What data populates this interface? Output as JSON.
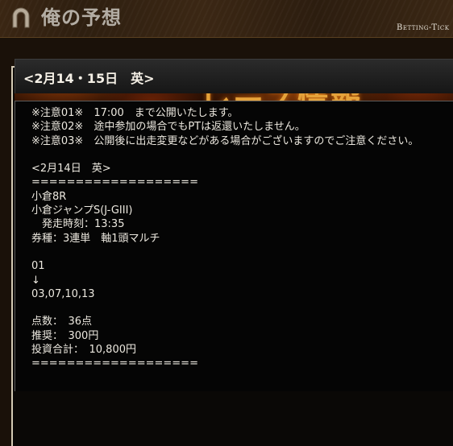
{
  "header": {
    "site_title": "俺の予想",
    "subtitle": "Betting-Tick",
    "logo_icon": "horseshoe-icon"
  },
  "banner": {
    "title": "レース情報"
  },
  "section": {
    "heading": "<2月14・15日　英>"
  },
  "content": {
    "lines": [
      "※注意01※　17:00　まで公開いたします。",
      "※注意02※　途中参加の場合でもPTは返還いたしません。",
      "※注意03※　公開後に出走変更などがある場合がございますのでご注意ください。",
      "",
      "<2月14日　英>",
      "===================",
      "小倉8R",
      "小倉ジャンプS(J-GIII)",
      "　発走時刻：13:35",
      "券種：3連単　軸1頭マルチ",
      "",
      "01",
      "↓",
      "03,07,10,13",
      "",
      "点数：　36点",
      "推奨：　300円",
      "投資合計：　10,800円",
      "==================="
    ]
  },
  "colors": {
    "header_bg": "#3a2613",
    "panel_border": "#d4cab4",
    "banner_text": "#e5a23a",
    "body_text": "#ece8df"
  }
}
